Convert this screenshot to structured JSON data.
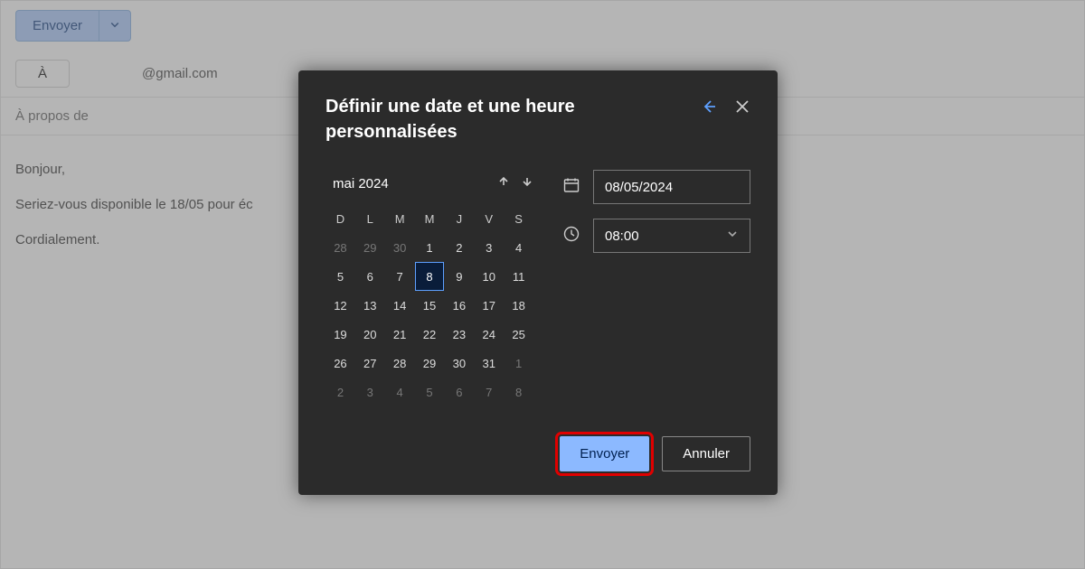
{
  "toolbar": {
    "send_label": "Envoyer"
  },
  "compose": {
    "to_label": "À",
    "address": "@gmail.com",
    "subject": "À propos de",
    "body_line1": "Bonjour,",
    "body_line2": "Seriez-vous disponible le 18/05 pour éc",
    "body_line3": "Cordialement."
  },
  "dialog": {
    "title": "Définir une date et une heure personnalisées",
    "month_label": "mai 2024",
    "day_headers": [
      "D",
      "L",
      "M",
      "M",
      "J",
      "V",
      "S"
    ],
    "weeks": [
      [
        {
          "n": "28",
          "dim": true
        },
        {
          "n": "29",
          "dim": true
        },
        {
          "n": "30",
          "dim": true
        },
        {
          "n": "1"
        },
        {
          "n": "2"
        },
        {
          "n": "3"
        },
        {
          "n": "4"
        }
      ],
      [
        {
          "n": "5"
        },
        {
          "n": "6"
        },
        {
          "n": "7"
        },
        {
          "n": "8",
          "sel": true
        },
        {
          "n": "9"
        },
        {
          "n": "10"
        },
        {
          "n": "11"
        }
      ],
      [
        {
          "n": "12"
        },
        {
          "n": "13"
        },
        {
          "n": "14"
        },
        {
          "n": "15"
        },
        {
          "n": "16"
        },
        {
          "n": "17"
        },
        {
          "n": "18"
        }
      ],
      [
        {
          "n": "19"
        },
        {
          "n": "20"
        },
        {
          "n": "21"
        },
        {
          "n": "22"
        },
        {
          "n": "23"
        },
        {
          "n": "24"
        },
        {
          "n": "25"
        }
      ],
      [
        {
          "n": "26"
        },
        {
          "n": "27"
        },
        {
          "n": "28"
        },
        {
          "n": "29"
        },
        {
          "n": "30"
        },
        {
          "n": "31"
        },
        {
          "n": "1",
          "dim": true
        }
      ],
      [
        {
          "n": "2",
          "dim": true
        },
        {
          "n": "3",
          "dim": true
        },
        {
          "n": "4",
          "dim": true
        },
        {
          "n": "5",
          "dim": true
        },
        {
          "n": "6",
          "dim": true
        },
        {
          "n": "7",
          "dim": true
        },
        {
          "n": "8",
          "dim": true
        }
      ]
    ],
    "date_value": "08/05/2024",
    "time_value": "08:00",
    "primary_label": "Envoyer",
    "secondary_label": "Annuler"
  }
}
